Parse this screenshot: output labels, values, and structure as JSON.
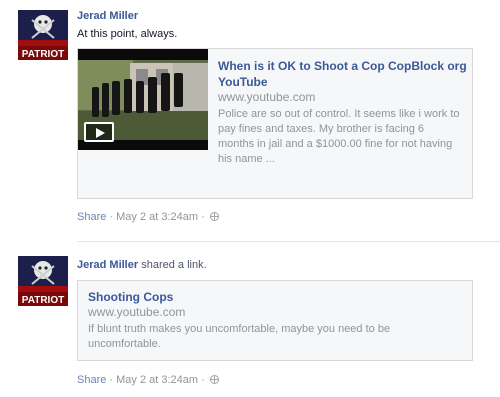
{
  "posts": [
    {
      "author": "Jerad Miller",
      "action": "",
      "message": "At this point, always.",
      "avatar_text": "PATRIOT",
      "link": {
        "title": "When is it OK to Shoot a Cop CopBlock org YouTube",
        "domain": "www.youtube.com",
        "description": "Police are so out of control. It seems like i work to pay fines and taxes. My brother is facing 6 months in jail and a $1000.00 fine for not having his name ..."
      },
      "meta": {
        "share": "Share",
        "separator": " · ",
        "time": "May 2 at 3:24am",
        "separator2": " · "
      }
    },
    {
      "author": "Jerad Miller",
      "action": "shared a link.",
      "avatar_text": "PATRIOT",
      "link": {
        "title": "Shooting Cops",
        "domain": "www.youtube.com",
        "description": "If blunt truth makes you uncomfortable, maybe you need to be uncomfortable."
      },
      "meta": {
        "share": "Share",
        "separator": " · ",
        "time": "May 2 at 3:24am",
        "separator2": " · "
      }
    }
  ],
  "icons": {
    "play": "play-icon",
    "globe": "globe-icon"
  },
  "colors": {
    "link": "#3b5998",
    "muted": "#90949c",
    "box_bg": "#f6f7f8"
  }
}
